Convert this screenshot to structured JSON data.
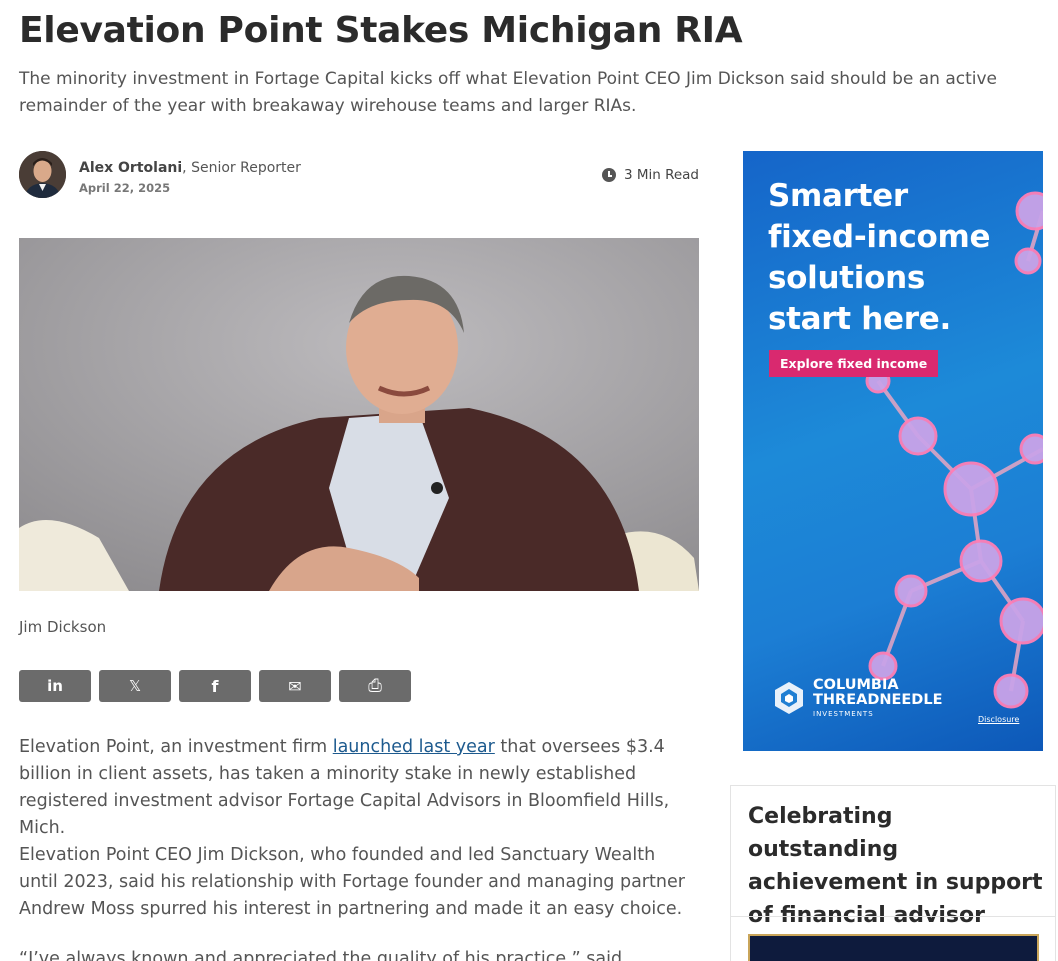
{
  "article": {
    "title": "Elevation Point Stakes Michigan RIA",
    "subtitle": "The minority investment in Fortage Capital kicks off what Elevation Point CEO Jim Dickson said should be an active remainder of the year with breakaway wirehouse teams and larger RIAs.",
    "author_name": "Alex Ortolani",
    "author_role": ", Senior Reporter",
    "date": "April 22, 2025",
    "read_time": "3 Min Read",
    "image_caption": "Jim Dickson",
    "share_buttons": [
      {
        "label": "in",
        "icon": "linkedin-icon"
      },
      {
        "label": "𝕏",
        "icon": "x-icon"
      },
      {
        "label": "f",
        "icon": "facebook-icon"
      },
      {
        "label": "✉",
        "icon": "email-icon"
      },
      {
        "label": "⎙",
        "icon": "print-icon"
      }
    ],
    "p1_before": "Elevation Point, an investment firm ",
    "p1_link": "launched last year",
    "p1_after": " that oversees $3.4 billion in client assets, has taken a minority stake in newly established registered investment advisor Fortage Capital Advisors in Bloomfield Hills, Mich.",
    "p2": "Elevation Point CEO Jim Dickson, who founded and led Sanctuary Wealth until 2023, said his relationship with Fortage founder and managing partner Andrew Moss spurred his interest in partnering and made it an easy choice.",
    "p3": "“I’ve always known and appreciated the quality of his practice,” said Dickson."
  },
  "ad": {
    "headline_lines": [
      "Smarter",
      "fixed-income",
      "solutions",
      "start here."
    ],
    "cta": "Explore fixed income",
    "brand_line1": "COLUMBIA",
    "brand_line2": "THREADNEEDLE",
    "brand_line3": "INVESTMENTS",
    "disclosure": "Disclosure",
    "colors": {
      "background": "#1c7ed4",
      "cta": "#d9296f"
    }
  },
  "sidebar_card": {
    "title": "Celebrating outstanding achievement in support of financial advisor success"
  },
  "colors": {
    "link": "#1d5a8e",
    "share_button": "#6b6b6b"
  }
}
